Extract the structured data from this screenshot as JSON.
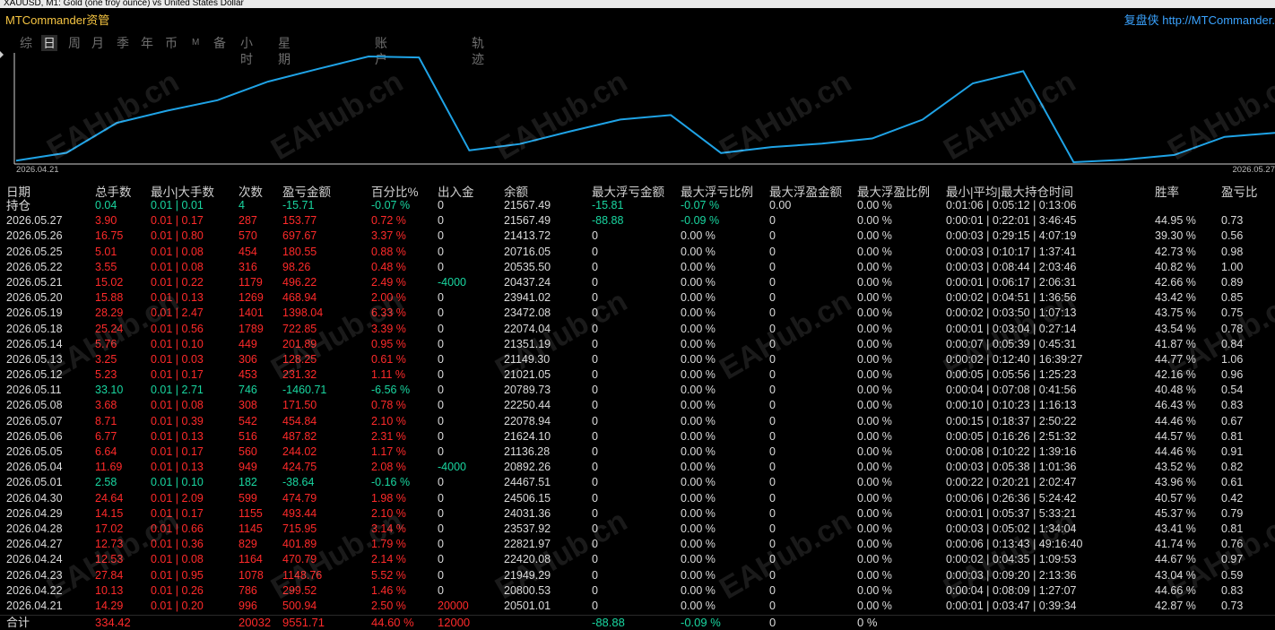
{
  "window": {
    "title": "XAUUSD, M1:  Gold (one troy ounce) vs United States Dollar"
  },
  "app": {
    "title": "MTCommander资管",
    "brand": "复盘侠 http://MTCommander."
  },
  "tabs": [
    {
      "label": "综",
      "active": false
    },
    {
      "label": "日",
      "active": true
    },
    {
      "label": "周",
      "active": false
    },
    {
      "label": "月",
      "active": false
    },
    {
      "label": "季",
      "active": false
    },
    {
      "label": "年",
      "active": false
    },
    {
      "label": "币",
      "active": false
    },
    {
      "label": "M",
      "active": false
    },
    {
      "label": "备",
      "active": false
    },
    {
      "label": "小时",
      "active": false
    },
    {
      "label": "星期",
      "active": false
    },
    {
      "label": "账户",
      "active": false
    },
    {
      "label": "轨迹",
      "active": false
    }
  ],
  "watermark": "EAHub.cn",
  "chart_data": {
    "type": "line",
    "x_start": "2026.04.21",
    "x_end": "2026.05.27",
    "color": "#1fa3e6",
    "x": [
      "2026.04.21",
      "2026.04.22",
      "2026.04.23",
      "2026.04.24",
      "2026.04.27",
      "2026.04.28",
      "2026.04.29",
      "2026.04.30",
      "2026.05.01",
      "2026.05.04",
      "2026.05.05",
      "2026.05.06",
      "2026.05.07",
      "2026.05.08",
      "2026.05.11",
      "2026.05.12",
      "2026.05.13",
      "2026.05.14",
      "2026.05.18",
      "2026.05.19",
      "2026.05.20",
      "2026.05.21",
      "2026.05.22",
      "2026.05.25",
      "2026.05.26",
      "2026.05.27"
    ],
    "values": [
      20501.01,
      20800.53,
      21949.29,
      22420.08,
      22821.97,
      23537.92,
      24031.36,
      24506.15,
      24467.51,
      20892.26,
      21136.28,
      21624.1,
      22078.94,
      22250.44,
      20789.73,
      21021.05,
      21149.3,
      21351.19,
      22074.04,
      23472.08,
      23941.02,
      20437.24,
      20535.5,
      20716.05,
      21413.72,
      21567.49
    ]
  },
  "columns": [
    "日期",
    "总手数",
    "最小|大手数",
    "次数",
    "盈亏金额",
    "百分比%",
    "出入金",
    "余额",
    "最大浮亏金额",
    "最大浮亏比例",
    "最大浮盈金额",
    "最大浮盈比例",
    "最小|平均|最大持仓时间",
    "胜率",
    "盈亏比"
  ],
  "holding": {
    "label": "持仓",
    "lots": "0.04",
    "minmax": "0.01 | 0.01",
    "count": "4",
    "pnl": "-15.71",
    "pct": "-0.07 %",
    "flow": "0",
    "balance": "21567.49",
    "maxfl": "-15.81",
    "maxflp": "-0.07 %",
    "maxfp": "0.00",
    "maxfpp": "0.00 %",
    "time": "0:01:06 | 0:05:12 | 0:13:06",
    "win": "",
    "pf": "",
    "color": "green"
  },
  "rows": [
    {
      "date": "2026.05.27",
      "lots": "3.90",
      "minmax": "0.01 | 0.17",
      "count": "287",
      "pnl": "153.77",
      "pct": "0.72 %",
      "flow": "0",
      "balance": "21567.49",
      "maxfl": "-88.88",
      "maxflp": "-0.09 %",
      "maxfp": "0",
      "maxfpp": "0.00 %",
      "time": "0:00:01 | 0:22:01 | 3:46:45",
      "win": "44.95 %",
      "pf": "0.73",
      "color": "red"
    },
    {
      "date": "2026.05.26",
      "lots": "16.75",
      "minmax": "0.01 | 0.80",
      "count": "570",
      "pnl": "697.67",
      "pct": "3.37 %",
      "flow": "0",
      "balance": "21413.72",
      "maxfl": "0",
      "maxflp": "0.00 %",
      "maxfp": "0",
      "maxfpp": "0.00 %",
      "time": "0:00:03 | 0:29:15 | 4:07:19",
      "win": "39.30 %",
      "pf": "0.56",
      "color": "red"
    },
    {
      "date": "2026.05.25",
      "lots": "5.01",
      "minmax": "0.01 | 0.08",
      "count": "454",
      "pnl": "180.55",
      "pct": "0.88 %",
      "flow": "0",
      "balance": "20716.05",
      "maxfl": "0",
      "maxflp": "0.00 %",
      "maxfp": "0",
      "maxfpp": "0.00 %",
      "time": "0:00:03 | 0:10:17 | 1:37:41",
      "win": "42.73 %",
      "pf": "0.98",
      "color": "red"
    },
    {
      "date": "2026.05.22",
      "lots": "3.55",
      "minmax": "0.01 | 0.08",
      "count": "316",
      "pnl": "98.26",
      "pct": "0.48 %",
      "flow": "0",
      "balance": "20535.50",
      "maxfl": "0",
      "maxflp": "0.00 %",
      "maxfp": "0",
      "maxfpp": "0.00 %",
      "time": "0:00:03 | 0:08:44 | 2:03:46",
      "win": "40.82 %",
      "pf": "1.00",
      "color": "red"
    },
    {
      "date": "2026.05.21",
      "lots": "15.02",
      "minmax": "0.01 | 0.22",
      "count": "1179",
      "pnl": "496.22",
      "pct": "2.49 %",
      "flow": "-4000",
      "balance": "20437.24",
      "maxfl": "0",
      "maxflp": "0.00 %",
      "maxfp": "0",
      "maxfpp": "0.00 %",
      "time": "0:00:01 | 0:06:17 | 2:06:31",
      "win": "42.66 %",
      "pf": "0.89",
      "color": "red",
      "flowColor": "green"
    },
    {
      "date": "2026.05.20",
      "lots": "15.88",
      "minmax": "0.01 | 0.13",
      "count": "1269",
      "pnl": "468.94",
      "pct": "2.00 %",
      "flow": "0",
      "balance": "23941.02",
      "maxfl": "0",
      "maxflp": "0.00 %",
      "maxfp": "0",
      "maxfpp": "0.00 %",
      "time": "0:00:02 | 0:04:51 | 1:36:56",
      "win": "43.42 %",
      "pf": "0.85",
      "color": "red"
    },
    {
      "date": "2026.05.19",
      "lots": "28.29",
      "minmax": "0.01 | 2.47",
      "count": "1401",
      "pnl": "1398.04",
      "pct": "6.33 %",
      "flow": "0",
      "balance": "23472.08",
      "maxfl": "0",
      "maxflp": "0.00 %",
      "maxfp": "0",
      "maxfpp": "0.00 %",
      "time": "0:00:02 | 0:03:50 | 1:07:13",
      "win": "43.75 %",
      "pf": "0.75",
      "color": "red"
    },
    {
      "date": "2026.05.18",
      "lots": "25.24",
      "minmax": "0.01 | 0.56",
      "count": "1789",
      "pnl": "722.85",
      "pct": "3.39 %",
      "flow": "0",
      "balance": "22074.04",
      "maxfl": "0",
      "maxflp": "0.00 %",
      "maxfp": "0",
      "maxfpp": "0.00 %",
      "time": "0:00:01 | 0:03:04 | 0:27:14",
      "win": "43.54 %",
      "pf": "0.78",
      "color": "red"
    },
    {
      "date": "2026.05.14",
      "lots": "5.76",
      "minmax": "0.01 | 0.10",
      "count": "449",
      "pnl": "201.89",
      "pct": "0.95 %",
      "flow": "0",
      "balance": "21351.19",
      "maxfl": "0",
      "maxflp": "0.00 %",
      "maxfp": "0",
      "maxfpp": "0.00 %",
      "time": "0:00:07 | 0:05:39 | 0:45:31",
      "win": "41.87 %",
      "pf": "0.84",
      "color": "red"
    },
    {
      "date": "2026.05.13",
      "lots": "3.25",
      "minmax": "0.01 | 0.03",
      "count": "306",
      "pnl": "128.25",
      "pct": "0.61 %",
      "flow": "0",
      "balance": "21149.30",
      "maxfl": "0",
      "maxflp": "0.00 %",
      "maxfp": "0",
      "maxfpp": "0.00 %",
      "time": "0:00:02 | 0:12:40 | 16:39:27",
      "win": "44.77 %",
      "pf": "1.06",
      "color": "red"
    },
    {
      "date": "2026.05.12",
      "lots": "5.23",
      "minmax": "0.01 | 0.17",
      "count": "453",
      "pnl": "231.32",
      "pct": "1.11 %",
      "flow": "0",
      "balance": "21021.05",
      "maxfl": "0",
      "maxflp": "0.00 %",
      "maxfp": "0",
      "maxfpp": "0.00 %",
      "time": "0:00:05 | 0:05:56 | 1:25:23",
      "win": "42.16 %",
      "pf": "0.96",
      "color": "red"
    },
    {
      "date": "2026.05.11",
      "lots": "33.10",
      "minmax": "0.01 | 2.71",
      "count": "746",
      "pnl": "-1460.71",
      "pct": "-6.56 %",
      "flow": "0",
      "balance": "20789.73",
      "maxfl": "0",
      "maxflp": "0.00 %",
      "maxfp": "0",
      "maxfpp": "0.00 %",
      "time": "0:00:04 | 0:07:08 | 0:41:56",
      "win": "40.48 %",
      "pf": "0.54",
      "color": "green"
    },
    {
      "date": "2026.05.08",
      "lots": "3.68",
      "minmax": "0.01 | 0.08",
      "count": "308",
      "pnl": "171.50",
      "pct": "0.78 %",
      "flow": "0",
      "balance": "22250.44",
      "maxfl": "0",
      "maxflp": "0.00 %",
      "maxfp": "0",
      "maxfpp": "0.00 %",
      "time": "0:00:10 | 0:10:23 | 1:16:13",
      "win": "46.43 %",
      "pf": "0.83",
      "color": "red"
    },
    {
      "date": "2026.05.07",
      "lots": "8.71",
      "minmax": "0.01 | 0.39",
      "count": "542",
      "pnl": "454.84",
      "pct": "2.10 %",
      "flow": "0",
      "balance": "22078.94",
      "maxfl": "0",
      "maxflp": "0.00 %",
      "maxfp": "0",
      "maxfpp": "0.00 %",
      "time": "0:00:15 | 0:18:37 | 2:50:22",
      "win": "44.46 %",
      "pf": "0.67",
      "color": "red"
    },
    {
      "date": "2026.05.06",
      "lots": "6.77",
      "minmax": "0.01 | 0.13",
      "count": "516",
      "pnl": "487.82",
      "pct": "2.31 %",
      "flow": "0",
      "balance": "21624.10",
      "maxfl": "0",
      "maxflp": "0.00 %",
      "maxfp": "0",
      "maxfpp": "0.00 %",
      "time": "0:00:05 | 0:16:26 | 2:51:32",
      "win": "44.57 %",
      "pf": "0.81",
      "color": "red"
    },
    {
      "date": "2026.05.05",
      "lots": "6.64",
      "minmax": "0.01 | 0.17",
      "count": "560",
      "pnl": "244.02",
      "pct": "1.17 %",
      "flow": "0",
      "balance": "21136.28",
      "maxfl": "0",
      "maxflp": "0.00 %",
      "maxfp": "0",
      "maxfpp": "0.00 %",
      "time": "0:00:08 | 0:10:22 | 1:39:16",
      "win": "44.46 %",
      "pf": "0.91",
      "color": "red"
    },
    {
      "date": "2026.05.04",
      "lots": "11.69",
      "minmax": "0.01 | 0.13",
      "count": "949",
      "pnl": "424.75",
      "pct": "2.08 %",
      "flow": "-4000",
      "balance": "20892.26",
      "maxfl": "0",
      "maxflp": "0.00 %",
      "maxfp": "0",
      "maxfpp": "0.00 %",
      "time": "0:00:03 | 0:05:38 | 1:01:36",
      "win": "43.52 %",
      "pf": "0.82",
      "color": "red",
      "flowColor": "green"
    },
    {
      "date": "2026.05.01",
      "lots": "2.58",
      "minmax": "0.01 | 0.10",
      "count": "182",
      "pnl": "-38.64",
      "pct": "-0.16 %",
      "flow": "0",
      "balance": "24467.51",
      "maxfl": "0",
      "maxflp": "0.00 %",
      "maxfp": "0",
      "maxfpp": "0.00 %",
      "time": "0:00:22 | 0:20:21 | 2:02:47",
      "win": "43.96 %",
      "pf": "0.61",
      "color": "green"
    },
    {
      "date": "2026.04.30",
      "lots": "24.64",
      "minmax": "0.01 | 2.09",
      "count": "599",
      "pnl": "474.79",
      "pct": "1.98 %",
      "flow": "0",
      "balance": "24506.15",
      "maxfl": "0",
      "maxflp": "0.00 %",
      "maxfp": "0",
      "maxfpp": "0.00 %",
      "time": "0:00:06 | 0:26:36 | 5:24:42",
      "win": "40.57 %",
      "pf": "0.42",
      "color": "red"
    },
    {
      "date": "2026.04.29",
      "lots": "14.15",
      "minmax": "0.01 | 0.17",
      "count": "1155",
      "pnl": "493.44",
      "pct": "2.10 %",
      "flow": "0",
      "balance": "24031.36",
      "maxfl": "0",
      "maxflp": "0.00 %",
      "maxfp": "0",
      "maxfpp": "0.00 %",
      "time": "0:00:01 | 0:05:37 | 5:33:21",
      "win": "45.37 %",
      "pf": "0.79",
      "color": "red"
    },
    {
      "date": "2026.04.28",
      "lots": "17.02",
      "minmax": "0.01 | 0.66",
      "count": "1145",
      "pnl": "715.95",
      "pct": "3.14 %",
      "flow": "0",
      "balance": "23537.92",
      "maxfl": "0",
      "maxflp": "0.00 %",
      "maxfp": "0",
      "maxfpp": "0.00 %",
      "time": "0:00:03 | 0:05:02 | 1:34:04",
      "win": "43.41 %",
      "pf": "0.81",
      "color": "red"
    },
    {
      "date": "2026.04.27",
      "lots": "12.73",
      "minmax": "0.01 | 0.36",
      "count": "829",
      "pnl": "401.89",
      "pct": "1.79 %",
      "flow": "0",
      "balance": "22821.97",
      "maxfl": "0",
      "maxflp": "0.00 %",
      "maxfp": "0",
      "maxfpp": "0.00 %",
      "time": "0:00:06 | 0:13:43 | 49:16:40",
      "win": "41.74 %",
      "pf": "0.76",
      "color": "red"
    },
    {
      "date": "2026.04.24",
      "lots": "12.53",
      "minmax": "0.01 | 0.08",
      "count": "1164",
      "pnl": "470.79",
      "pct": "2.14 %",
      "flow": "0",
      "balance": "22420.08",
      "maxfl": "0",
      "maxflp": "0.00 %",
      "maxfp": "0",
      "maxfpp": "0.00 %",
      "time": "0:00:02 | 0:04:35 | 1:09:53",
      "win": "44.67 %",
      "pf": "0.97",
      "color": "red"
    },
    {
      "date": "2026.04.23",
      "lots": "27.84",
      "minmax": "0.01 | 0.95",
      "count": "1078",
      "pnl": "1148.76",
      "pct": "5.52 %",
      "flow": "0",
      "balance": "21949.29",
      "maxfl": "0",
      "maxflp": "0.00 %",
      "maxfp": "0",
      "maxfpp": "0.00 %",
      "time": "0:00:03 | 0:09:20 | 2:13:36",
      "win": "43.04 %",
      "pf": "0.59",
      "color": "red"
    },
    {
      "date": "2026.04.22",
      "lots": "10.13",
      "minmax": "0.01 | 0.26",
      "count": "786",
      "pnl": "299.52",
      "pct": "1.46 %",
      "flow": "0",
      "balance": "20800.53",
      "maxfl": "0",
      "maxflp": "0.00 %",
      "maxfp": "0",
      "maxfpp": "0.00 %",
      "time": "0:00:04 | 0:08:09 | 1:27:07",
      "win": "44.66 %",
      "pf": "0.83",
      "color": "red"
    },
    {
      "date": "2026.04.21",
      "lots": "14.29",
      "minmax": "0.01 | 0.20",
      "count": "996",
      "pnl": "500.94",
      "pct": "2.50 %",
      "flow": "20000",
      "balance": "20501.01",
      "maxfl": "0",
      "maxflp": "0.00 %",
      "maxfp": "0",
      "maxfpp": "0.00 %",
      "time": "0:00:01 | 0:03:47 | 0:39:34",
      "win": "42.87 %",
      "pf": "0.73",
      "color": "red",
      "flowColor": "red"
    }
  ],
  "total": {
    "label": "合计",
    "lots": "334.42",
    "count": "20032",
    "pnl": "9551.71",
    "pct": "44.60 %",
    "flow": "12000",
    "maxfl": "-88.88",
    "maxflp": "-0.09 %",
    "maxfp": "0",
    "maxfpp": "0 %"
  }
}
